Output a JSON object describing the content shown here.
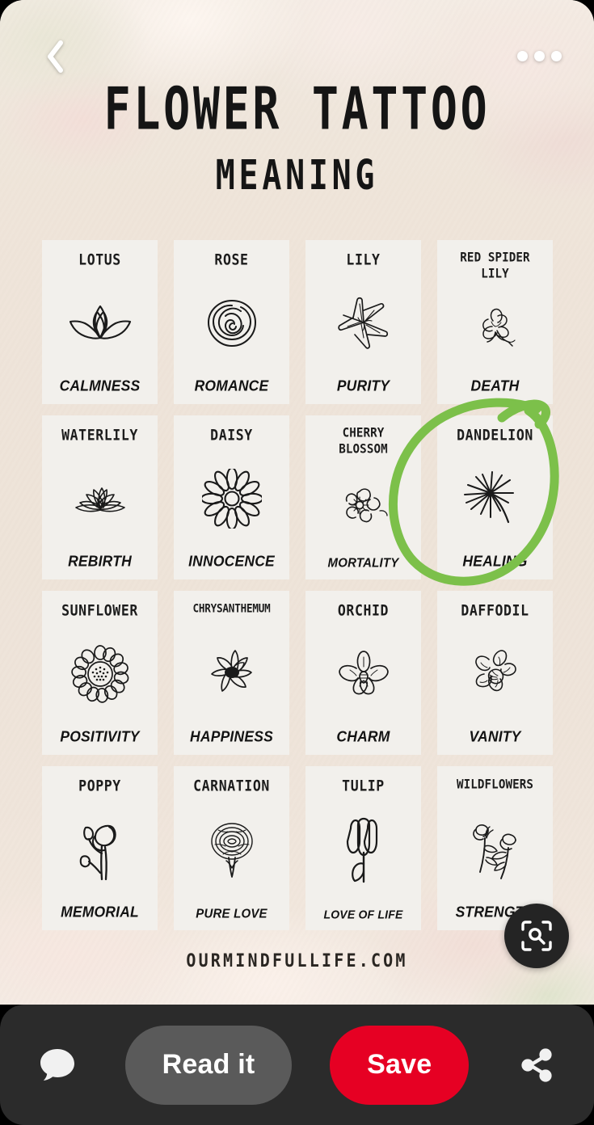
{
  "header": {
    "back_icon": "chevron-left-icon",
    "menu_icon": "more-options-icon"
  },
  "pin": {
    "title": "FLOWER TATTOO",
    "subtitle": "MEANING",
    "watermark": "OURMINDFULLIFE.COM",
    "lens_icon": "visual-search-lens-icon",
    "background_color": "#efe5dc",
    "card_color": "#f2f0ec"
  },
  "annotation": {
    "type": "hand-drawn-circle",
    "color": "#7cc04a",
    "target": "DANDELION"
  },
  "cards": [
    {
      "name": "LOTUS",
      "meaning": "CALMNESS",
      "icon": "lotus-flower-icon"
    },
    {
      "name": "ROSE",
      "meaning": "ROMANCE",
      "icon": "rose-flower-icon"
    },
    {
      "name": "LILY",
      "meaning": "PURITY",
      "icon": "lily-flower-icon"
    },
    {
      "name": "RED SPIDER\nLILY",
      "meaning": "DEATH",
      "icon": "red-spider-lily-icon"
    },
    {
      "name": "WATERLILY",
      "meaning": "REBIRTH",
      "icon": "waterlily-flower-icon"
    },
    {
      "name": "DAISY",
      "meaning": "INNOCENCE",
      "icon": "daisy-flower-icon"
    },
    {
      "name": "CHERRY\nBLOSSOM",
      "meaning": "MORTALITY",
      "icon": "cherry-blossom-icon"
    },
    {
      "name": "DANDELION",
      "meaning": "HEALING",
      "icon": "dandelion-seed-icon"
    },
    {
      "name": "SUNFLOWER",
      "meaning": "POSITIVITY",
      "icon": "sunflower-icon"
    },
    {
      "name": "CHRYSANTHEMUM",
      "meaning": "HAPPINESS",
      "icon": "chrysanthemum-icon"
    },
    {
      "name": "ORCHID",
      "meaning": "CHARM",
      "icon": "orchid-flower-icon"
    },
    {
      "name": "DAFFODIL",
      "meaning": "VANITY",
      "icon": "daffodil-flower-icon"
    },
    {
      "name": "POPPY",
      "meaning": "MEMORIAL",
      "icon": "poppy-flower-icon"
    },
    {
      "name": "CARNATION",
      "meaning": "PURE LOVE",
      "icon": "carnation-flower-icon"
    },
    {
      "name": "TULIP",
      "meaning": "LOVE OF LIFE",
      "icon": "tulip-flower-icon"
    },
    {
      "name": "WILDFLOWERS",
      "meaning": "STRENGTH",
      "icon": "wildflowers-icon"
    }
  ],
  "actionbar": {
    "comment_icon": "comment-bubble-icon",
    "read_label": "Read it",
    "save_label": "Save",
    "share_icon": "share-icon",
    "save_color": "#e60023",
    "read_color": "#5a5a5a"
  }
}
